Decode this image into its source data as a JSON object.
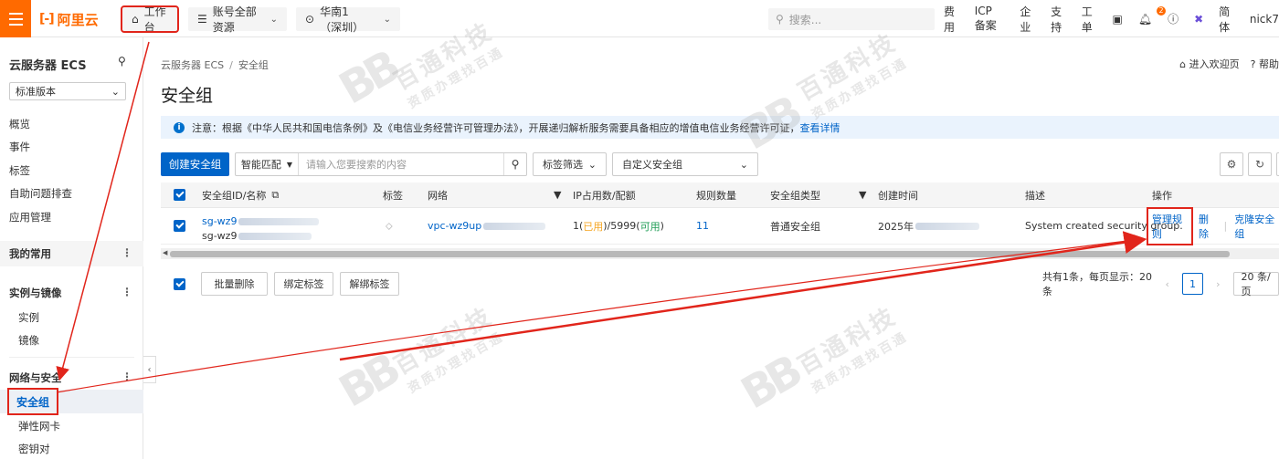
{
  "topbar": {
    "brand": "阿里云",
    "workbench": "工作台",
    "resources": "账号全部资源",
    "region": "华南1（深圳）",
    "search_placeholder": "搜索...",
    "links": [
      "费用",
      "ICP 备案",
      "企业",
      "支持",
      "工单"
    ],
    "notification_count": "2",
    "language": "简体",
    "user": "nick7"
  },
  "sidebar": {
    "title": "云服务器 ECS",
    "edition": "标准版本",
    "items": [
      "概览",
      "事件",
      "标签",
      "自助问题排查",
      "应用管理"
    ],
    "group_favorites": "我的常用",
    "group_instances": "实例与镜像",
    "instances_items": [
      "实例",
      "镜像"
    ],
    "group_network": "网络与安全",
    "network_items": [
      "安全组",
      "弹性网卡",
      "密钥对"
    ]
  },
  "main": {
    "breadcrumb": [
      "云服务器 ECS",
      "安全组"
    ],
    "welcome": "进入欢迎页",
    "help": "帮助",
    "title": "安全组",
    "notice_text": "注意：根据《中华人民共和国电信条例》及《电信业务经营许可管理办法》，开展递归解析服务需要具备相应的增值电信业务经营许可证，",
    "notice_link": "查看详情",
    "create_button": "创建安全组",
    "match_label": "智能匹配",
    "search_placeholder": "请输入您要搜索的内容",
    "tag_filter": "标签筛选",
    "custom_group": "自定义安全组"
  },
  "table": {
    "headers": [
      "安全组ID/名称",
      "标签",
      "网络",
      "IP占用数/配额",
      "规则数量",
      "安全组类型",
      "创建时间",
      "描述",
      "操作"
    ],
    "row": {
      "id": "sg-wz9",
      "name": "sg-wz9",
      "vpc": "vpc-wz9up",
      "ip_used": "1",
      "ip_used_label": "已用",
      "ip_quota": "5999",
      "ip_available_label": "可用",
      "rules": "11",
      "type": "普通安全组",
      "created": "2025年",
      "description": "System created security group.",
      "manage_rules": "管理规则",
      "delete": "删除",
      "clone": "克隆安全组"
    }
  },
  "footer": {
    "batch_delete": "批量删除",
    "bind_tag": "绑定标签",
    "unbind_tag": "解绑标签",
    "summary": "共有1条，每页显示：20条",
    "page": "1",
    "page_size": "20 条/页"
  },
  "watermark": {
    "logo": "BB",
    "company": "百通科技",
    "slogan": "资质办理找百通"
  },
  "colors": {
    "brand": "#ff6a00",
    "primary": "#0064c8",
    "annotation": "#e1251b"
  }
}
